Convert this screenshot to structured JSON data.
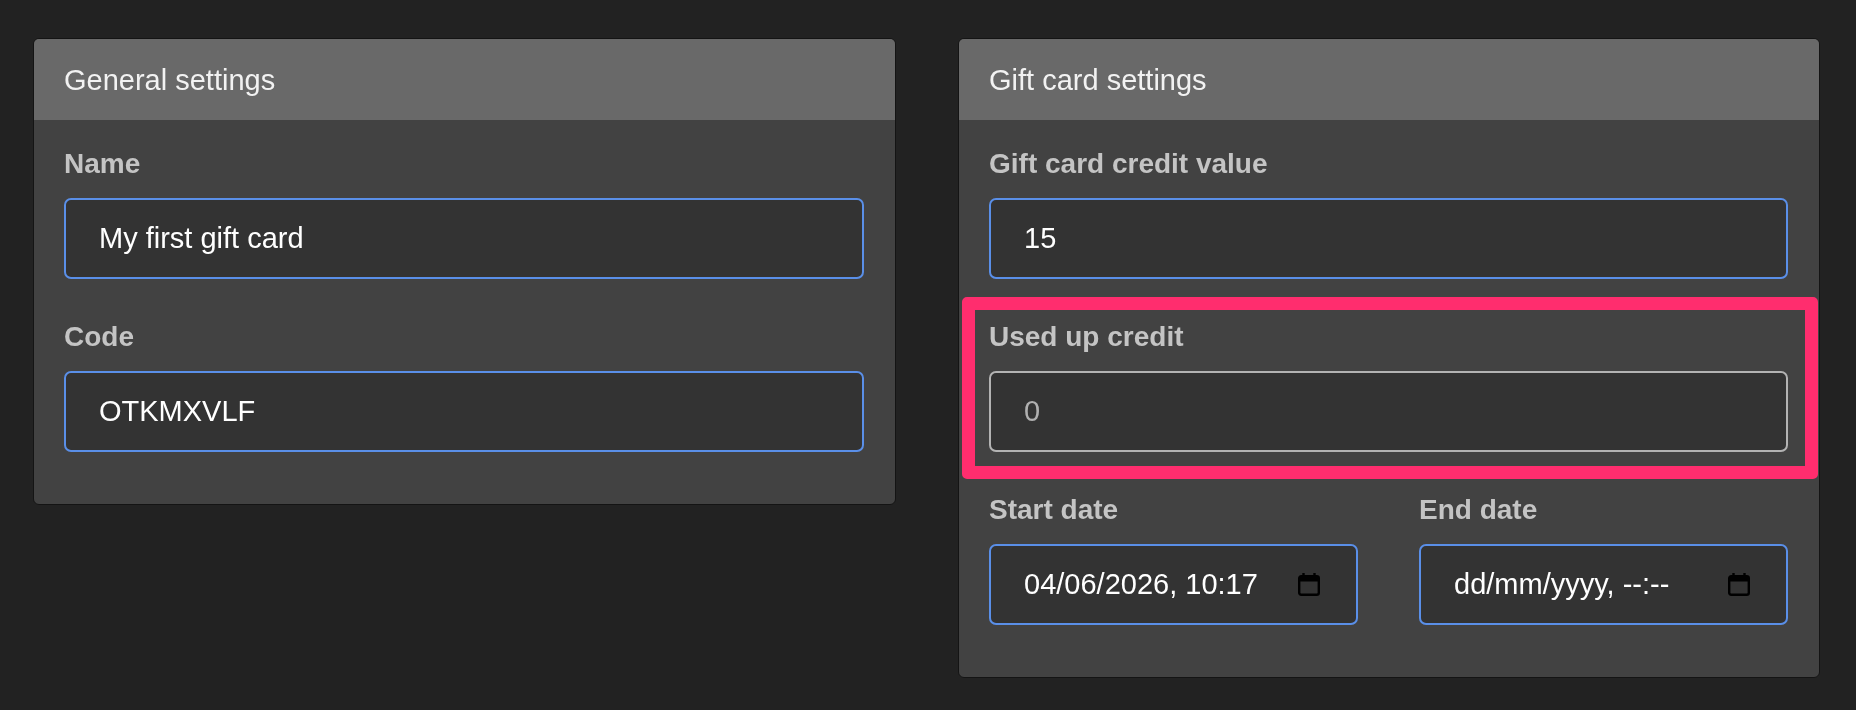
{
  "cards": [
    {
      "title": "General settings",
      "fields": [
        {
          "kind": "text",
          "label": "Name",
          "value": "My first gift card",
          "disabled": false,
          "highlighted": false
        },
        {
          "kind": "text",
          "label": "Code",
          "value": "OTKMXVLF",
          "disabled": false,
          "highlighted": false
        }
      ]
    },
    {
      "title": "Gift card settings",
      "fields": [
        {
          "kind": "text",
          "label": "Gift card credit value",
          "value": "15",
          "disabled": false,
          "highlighted": false
        },
        {
          "kind": "text",
          "label": "Used up credit",
          "value": "0",
          "disabled": true,
          "highlighted": true
        }
      ],
      "date_fields": [
        {
          "label": "Start date",
          "value": "04/06/2026, 10:17"
        },
        {
          "label": "End date",
          "placeholder": "dd/mm/yyyy, --:--"
        }
      ]
    }
  ]
}
